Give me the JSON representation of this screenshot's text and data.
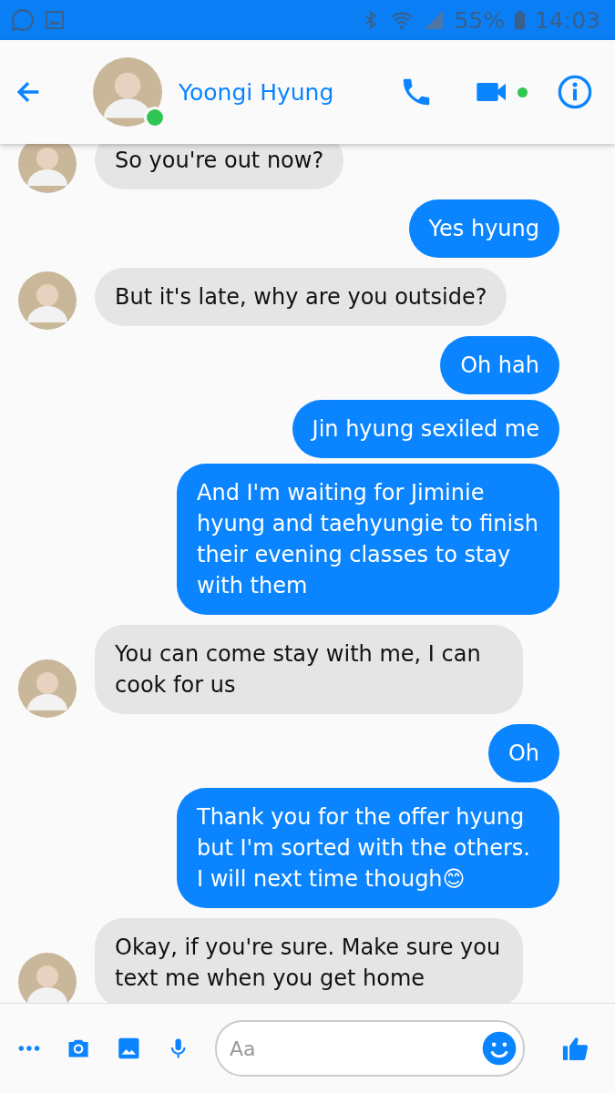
{
  "status_bar": {
    "battery": "55%",
    "time": "14:03"
  },
  "header": {
    "contact_name": "Yoongi Hyung",
    "online": true,
    "video_available": true
  },
  "messages": [
    {
      "kind": "incoming",
      "text": "So you're out now?"
    },
    {
      "kind": "outgoing",
      "text": "Yes hyung"
    },
    {
      "kind": "incoming",
      "text": "But it's late, why are you outside?"
    },
    {
      "kind": "outgoing",
      "text": "Oh hah"
    },
    {
      "kind": "outgoing",
      "text": "Jin hyung sexiled me"
    },
    {
      "kind": "outgoing",
      "text": "And I'm waiting for Jiminie hyung and taehyungie to finish their evening classes to stay with them"
    },
    {
      "kind": "incoming",
      "text": "You can come stay with me, I can cook for us"
    },
    {
      "kind": "outgoing",
      "text": "Oh"
    },
    {
      "kind": "outgoing",
      "text": "Thank you for the offer hyung but I'm sorted with the others. I will next time though😊"
    },
    {
      "kind": "incoming",
      "text": "Okay, if you're sure. Make sure you text me when you get home"
    }
  ],
  "composer": {
    "placeholder": "Aa"
  }
}
